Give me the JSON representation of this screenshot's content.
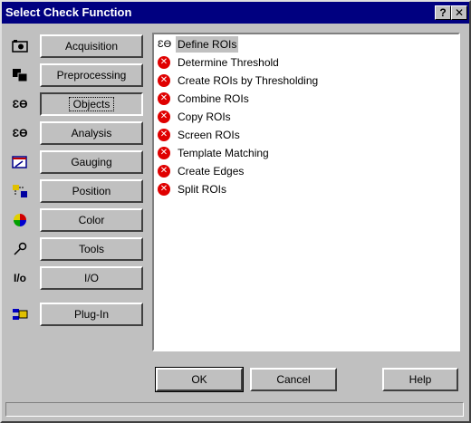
{
  "window": {
    "title": "Select Check Function",
    "help_glyph": "?",
    "close_glyph": "✕"
  },
  "categories": [
    {
      "label": "Acquisition",
      "icon": "camera-icon"
    },
    {
      "label": "Preprocessing",
      "icon": "preprocessing-icon"
    },
    {
      "label": "Objects",
      "icon": "objects-icon",
      "active": true
    },
    {
      "label": "Analysis",
      "icon": "analysis-icon"
    },
    {
      "label": "Gauging",
      "icon": "gauging-icon"
    },
    {
      "label": "Position",
      "icon": "position-icon"
    },
    {
      "label": "Color",
      "icon": "color-wheel-icon"
    },
    {
      "label": "Tools",
      "icon": "wrench-icon"
    },
    {
      "label": "I/O",
      "icon": "io-icon"
    },
    {
      "label": "Plug-In",
      "icon": "plugin-icon"
    }
  ],
  "functions": [
    {
      "label": "Define ROIs",
      "icon": "roi-icon",
      "selected": true
    },
    {
      "label": "Determine Threshold",
      "icon": "error-icon"
    },
    {
      "label": "Create ROIs by Thresholding",
      "icon": "error-icon"
    },
    {
      "label": "Combine ROIs",
      "icon": "error-icon"
    },
    {
      "label": "Copy ROIs",
      "icon": "error-icon"
    },
    {
      "label": "Screen ROIs",
      "icon": "error-icon"
    },
    {
      "label": "Template Matching",
      "icon": "error-icon"
    },
    {
      "label": "Create Edges",
      "icon": "error-icon"
    },
    {
      "label": "Split ROIs",
      "icon": "error-icon"
    }
  ],
  "buttons": {
    "ok": "OK",
    "cancel": "Cancel",
    "help": "Help"
  },
  "icon_glyphs": {
    "roi": "ƐƟ",
    "error": "✕",
    "io": "I/o"
  },
  "colors": {
    "titlebar": "#000080",
    "face": "#c0c0c0",
    "error": "#e00000"
  }
}
